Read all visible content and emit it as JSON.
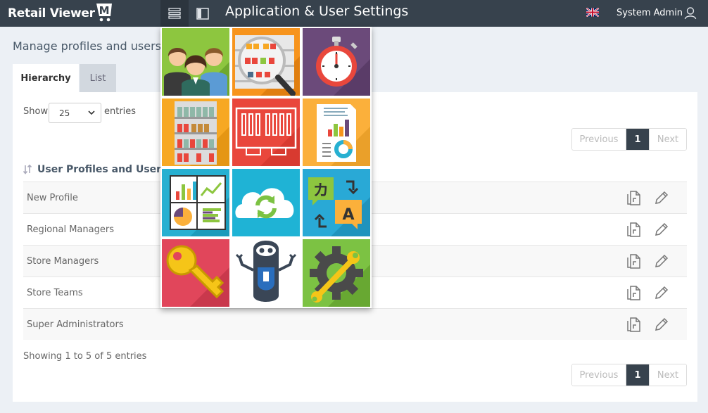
{
  "header": {
    "brand": "Retail Viewer",
    "brand_mark": "M",
    "title": "Application & User Settings",
    "user_name": "System Admin",
    "language": "en-GB"
  },
  "page": {
    "title": "Manage profiles and users",
    "tabs": [
      {
        "label": "Hierarchy",
        "active": true
      },
      {
        "label": "List",
        "active": false
      }
    ]
  },
  "table_controls": {
    "show_label": "Show",
    "page_size": "25",
    "entries_label": "entries",
    "pager": {
      "previous": "Previous",
      "current": "1",
      "next": "Next"
    },
    "info": "Showing 1 to 5 of 5 entries"
  },
  "section": {
    "title": "User Profiles and Users"
  },
  "profiles": [
    "New Profile",
    "Regional Managers",
    "Store Managers",
    "Store Teams",
    "Super Administrators"
  ],
  "app_menu": {
    "tiles": [
      {
        "icon": "users-group-icon",
        "bg": "#8dc63f"
      },
      {
        "icon": "magnifier-shelf-icon",
        "bg": "#f7941d"
      },
      {
        "icon": "stopwatch-icon",
        "bg": "#6b4a7a"
      },
      {
        "icon": "store-shelves-icon",
        "bg": "#f7a823"
      },
      {
        "icon": "floor-plan-icon",
        "bg": "#e9473c"
      },
      {
        "icon": "report-document-icon",
        "bg": "#fbb03b"
      },
      {
        "icon": "dashboard-charts-icon",
        "bg": "#27b0d1"
      },
      {
        "icon": "cloud-sync-icon",
        "bg": "#1fb3d5"
      },
      {
        "icon": "translate-icon",
        "bg": "#29a9d6"
      },
      {
        "icon": "key-icon",
        "bg": "#e1465b"
      },
      {
        "icon": "robot-icon",
        "bg": "#ffffff"
      },
      {
        "icon": "settings-gear-icon",
        "bg": "#7cc243"
      }
    ]
  },
  "colors": {
    "topbar": "#37424d",
    "page_bg": "#ecf0f5",
    "pager_active": "#37424d"
  }
}
